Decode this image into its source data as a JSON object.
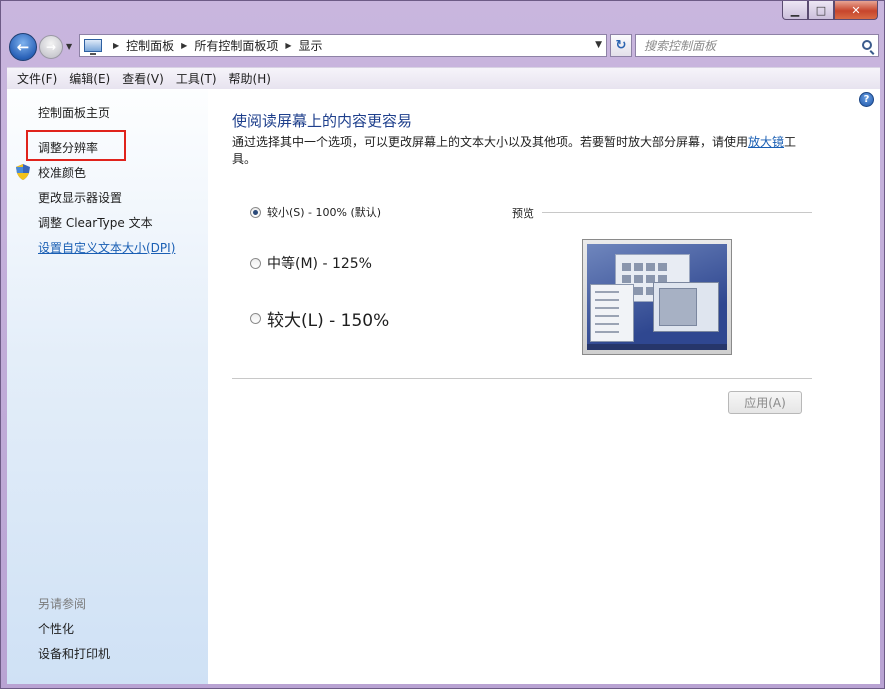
{
  "window": {
    "caption_buttons": {
      "minimize": "▁",
      "maximize": "□",
      "close": "✕"
    }
  },
  "navigation": {
    "back_glyph": "←",
    "forward_glyph": "→",
    "breadcrumbs": [
      "控制面板",
      "所有控制面板项",
      "显示"
    ],
    "search_placeholder": "搜索控制面板"
  },
  "menubar": {
    "items": [
      "文件(F)",
      "编辑(E)",
      "查看(V)",
      "工具(T)",
      "帮助(H)"
    ]
  },
  "sidebar": {
    "items": [
      {
        "label": "控制面板主页"
      },
      {
        "label": "调整分辨率",
        "highlighted": true
      },
      {
        "label": "校准颜色",
        "icon": "shield-icon"
      },
      {
        "label": "更改显示器设置"
      },
      {
        "label": "调整 ClearType 文本"
      },
      {
        "label": "设置自定义文本大小(DPI)",
        "link": true
      }
    ],
    "see_also_heading": "另请参阅",
    "see_also": [
      "个性化",
      "设备和打印机"
    ]
  },
  "main": {
    "title": "使阅读屏幕上的内容更容易",
    "description_before_link": "通过选择其中一个选项，可以更改屏幕上的文本大小以及其他项。若要暂时放大部分屏幕，请使用",
    "description_link": "放大镜",
    "description_after_link": "工具。",
    "options": [
      {
        "label": "较小(S) - 100% (默认)",
        "selected": true
      },
      {
        "label": "中等(M) - 125%",
        "selected": false
      },
      {
        "label": "较大(L) - 150%",
        "selected": false
      }
    ],
    "preview_label": "预览",
    "apply_button": "应用(A)",
    "apply_enabled": false
  },
  "colors": {
    "title_blue": "#1e3f8c",
    "link_blue": "#1a5fb4",
    "highlight_red": "#e0231c",
    "frame_purple": "#c9b6de"
  }
}
